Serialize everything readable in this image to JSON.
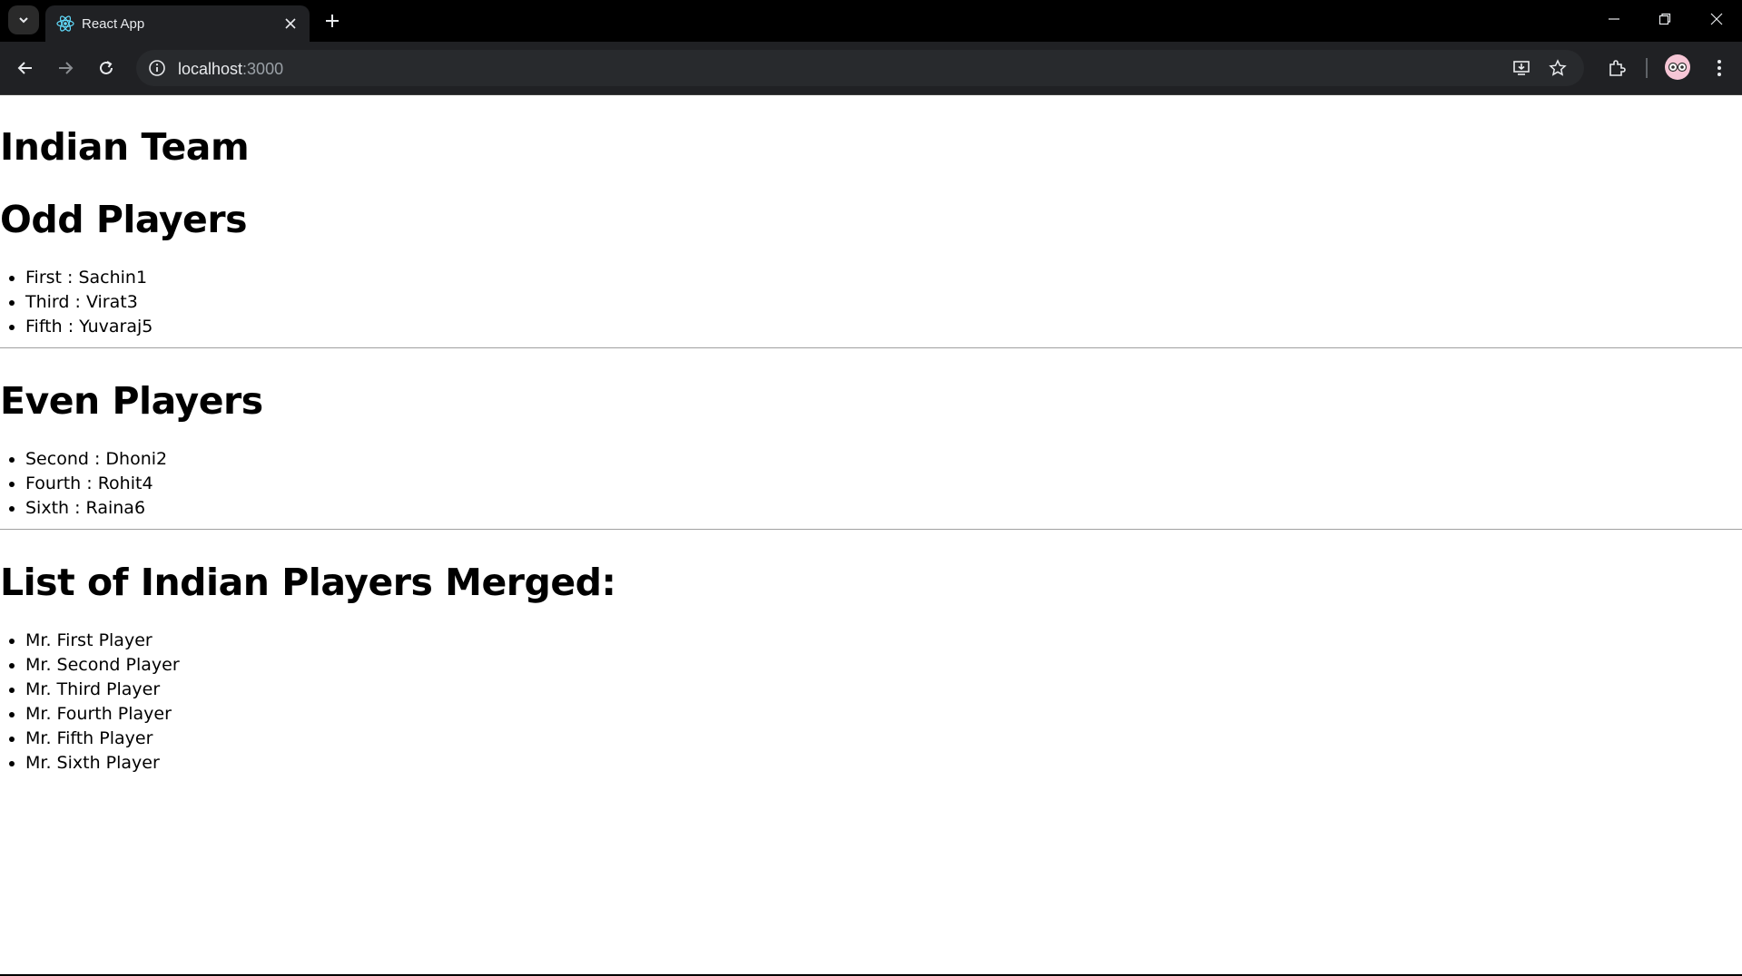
{
  "browser": {
    "tab": {
      "title": "React App",
      "favicon": "react-logo-icon"
    },
    "url": {
      "host": "localhost",
      "port": ":3000"
    },
    "icons": {
      "tab_search": "chevron-down-icon",
      "close_tab": "close-icon",
      "new_tab": "plus-icon",
      "minimize": "minimize-icon",
      "restore": "restore-icon",
      "close_window": "close-icon",
      "back": "arrow-left-icon",
      "forward": "arrow-right-icon",
      "reload": "reload-icon",
      "site_info": "info-icon",
      "install": "install-app-icon",
      "bookmark": "star-icon",
      "extensions": "puzzle-icon",
      "profile": "avatar-icon",
      "menu": "kebab-menu-icon"
    }
  },
  "page": {
    "title": "Indian Team",
    "odd": {
      "heading": "Odd Players",
      "items": [
        "First : Sachin1",
        "Third : Virat3",
        "Fifth : Yuvaraj5"
      ]
    },
    "even": {
      "heading": "Even Players",
      "items": [
        "Second : Dhoni2",
        "Fourth : Rohit4",
        "Sixth : Raina6"
      ]
    },
    "merged": {
      "heading": "List of Indian Players Merged:",
      "items": [
        "Mr. First Player",
        "Mr. Second Player",
        "Mr. Third Player",
        "Mr. Fourth Player",
        "Mr. Fifth Player",
        "Mr. Sixth Player"
      ]
    }
  }
}
